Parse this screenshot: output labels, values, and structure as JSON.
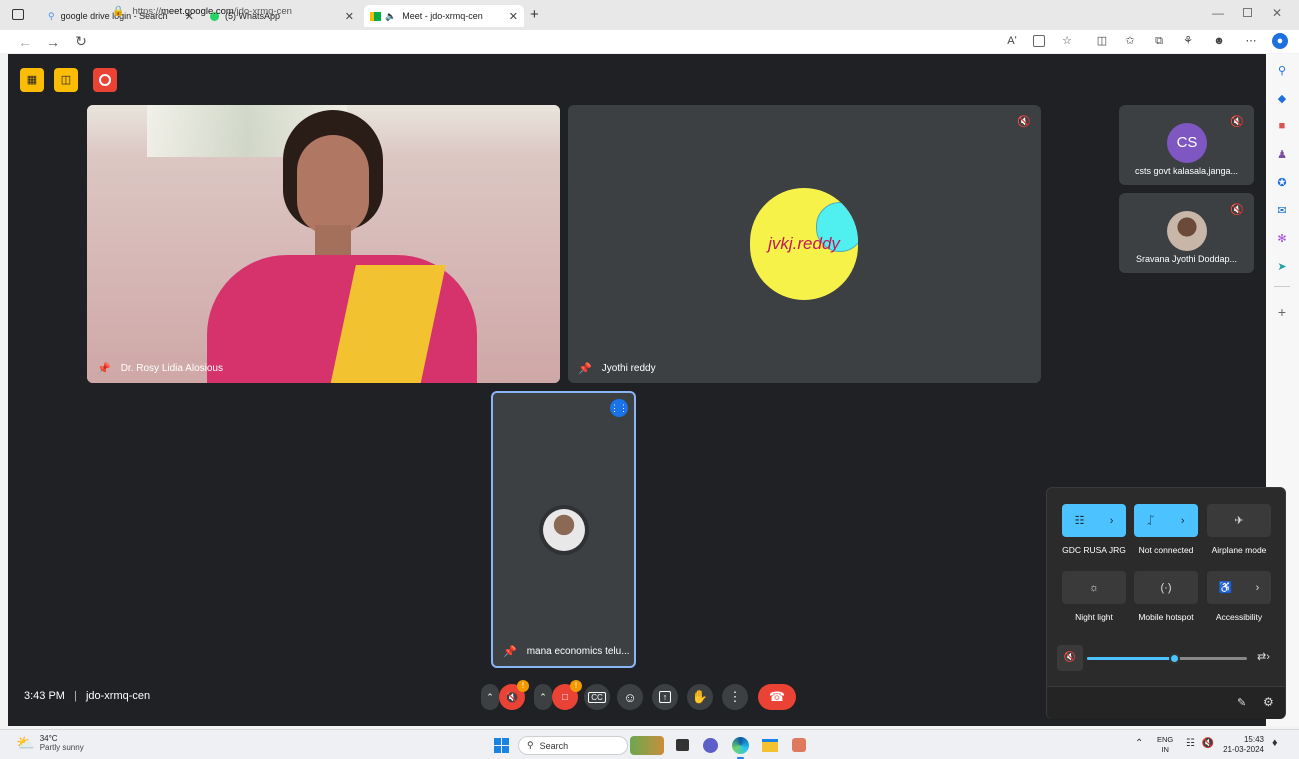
{
  "browser": {
    "tabs": [
      {
        "label": "google drive login - Search",
        "active": false
      },
      {
        "label": "(5) WhatsApp",
        "active": false
      },
      {
        "label": "Meet - jdo-xrmq-cen",
        "active": true
      }
    ],
    "url_prefix": "https://",
    "url_host": "meet.google.com",
    "url_path": "/jdo-xrmq-cen",
    "read_aloud": "Aʹ"
  },
  "meet": {
    "time": "3:43 PM",
    "meeting_code": "jdo-xrmq-cen",
    "tiles": {
      "main1": {
        "name": "Dr. Rosy Lidia Alosious"
      },
      "main2": {
        "name": "Jyothi reddy",
        "avatar_text": "jvkj.reddy"
      },
      "focus": {
        "name": "mana economics telu..."
      },
      "side1": {
        "name": "csts govt kalasala,janga...",
        "initials": "CS"
      },
      "side2": {
        "name": "Sravana Jyothi Doddap..."
      }
    },
    "controls": {
      "mic_badge": "!",
      "cam_badge": "!",
      "cc_label": "CC"
    }
  },
  "quick_settings": {
    "wifi_label": "GDC RUSA JRG",
    "bt_label": "Not connected",
    "airplane_label": "Airplane mode",
    "night_label": "Night light",
    "hotspot_label": "Mobile hotspot",
    "access_label": "Accessibility",
    "volume_percent": 55,
    "colors": {
      "accent": "#4cc2ff",
      "panel": "#2b2b2b"
    }
  },
  "taskbar": {
    "weather_temp": "34°C",
    "weather_desc": "Partly sunny",
    "search_placeholder": "Search",
    "lang_top": "ENG",
    "lang_bottom": "IN",
    "clock_time": "15:43",
    "clock_date": "21-03-2024"
  },
  "colors": {
    "meet_bg": "#202124",
    "end_call": "#ea4335",
    "highlight": "#8ab4f8"
  }
}
